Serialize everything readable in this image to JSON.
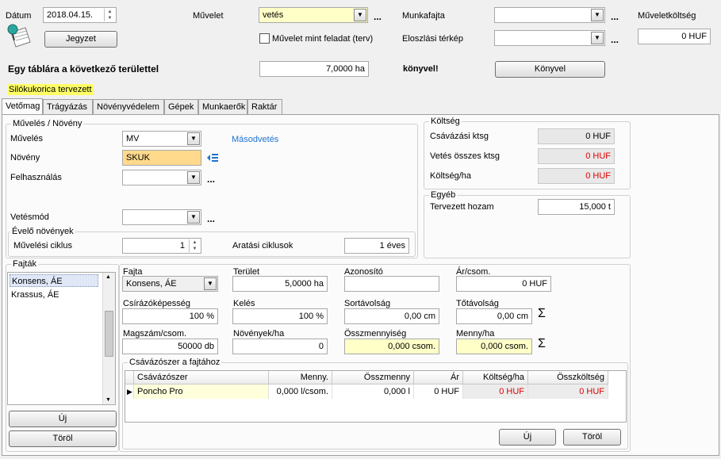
{
  "header": {
    "datum_label": "Dátum",
    "datum_value": "2018.04.15.",
    "jegyzet_button": "Jegyzet",
    "muvelet_label": "Művelet",
    "muvelet_value": "vetés",
    "muvelet_feladat_label": "Művelet mint feladat (terv)",
    "munkafajta_label": "Munkafajta",
    "munkafajta_value": "",
    "eloszlasi_label": "Eloszlási térkép",
    "eloszlasi_value": "",
    "muveletkoltseg_label": "Műveletköltség",
    "muveletkoltseg_value": "0 HUF",
    "dots": "..."
  },
  "book": {
    "text": "Egy táblára a következő területtel",
    "area_value": "7,0000 ha",
    "konyvel_text": "könyvel!",
    "konyvel_button": "Könyvel",
    "plan_name": "Silókukorica tervezett"
  },
  "tabs": [
    "Vetőmag",
    "Trágyázás",
    "Növényvédelem",
    "Gépek",
    "Munkaerők",
    "Raktár"
  ],
  "muveles": {
    "group_title": "Művelés / Növény",
    "muveles_label": "Művelés",
    "muveles_value": "MV",
    "masodvetes_link": "Másodvetés",
    "noveny_label": "Növény",
    "noveny_value": "SKUK",
    "felhasznalas_label": "Felhasználás",
    "felhasznalas_value": "",
    "vetesmod_label": "Vetésmód",
    "vetesmod_value": "",
    "evelo_title": "Évelő növények",
    "muveleci_ciklus_label": "Művelési ciklus",
    "muveleci_ciklus_value": "1",
    "aratasi_label": "Aratási ciklusok",
    "aratasi_value": "1 éves"
  },
  "koltseg": {
    "group_title": "Költség",
    "csavazasi_label": "Csávázási ktsg",
    "csavazasi_value": "0 HUF",
    "vetes_osszes_label": "Vetés összes ktsg",
    "vetes_osszes_value": "0 HUF",
    "koltseg_ha_label": "Költség/ha",
    "koltseg_ha_value": "0 HUF"
  },
  "egyeb": {
    "group_title": "Egyéb",
    "hozam_label": "Tervezett hozam",
    "hozam_value": "15,000 t"
  },
  "fajtak": {
    "group_title": "Fajták",
    "items": [
      "Konsens, ÁE",
      "Krassus, ÁE"
    ],
    "uj_button": "Új",
    "torol_button": "Töröl"
  },
  "fajta_detail": {
    "fajta_label": "Fajta",
    "fajta_value": "Konsens, ÁE",
    "terulet_label": "Terület",
    "terulet_value": "5,0000 ha",
    "azonosito_label": "Azonosító",
    "azonosito_value": "",
    "ar_csom_label": "Ár/csom.",
    "ar_csom_value": "0 HUF",
    "csirazo_label": "Csírázóképesség",
    "csirazo_value": "100 %",
    "keles_label": "Kelés",
    "keles_value": "100 %",
    "sortav_label": "Sortávolság",
    "sortav_value": "0,00 cm",
    "totav_label": "Tőtávolság",
    "totav_value": "0,00 cm",
    "magszam_label": "Magszám/csom.",
    "magszam_value": "50000 db",
    "noveny_ha_label": "Növények/ha",
    "noveny_ha_value": "0",
    "osszmenny_label": "Összmennyiség",
    "osszmenny_value": "0,000 csom.",
    "menny_ha_label": "Menny/ha",
    "menny_ha_value": "0,000 csom.",
    "sigma": "Σ"
  },
  "csavazoszer": {
    "group_title": "Csávázószer a fajtához",
    "columns": [
      "Csávázószer",
      "Menny.",
      "Összmenny",
      "Ár",
      "Költség/ha",
      "Összköltség"
    ],
    "rows": [
      {
        "name": "Poncho Pro",
        "menny": "0,000 l/csom.",
        "osszmenny": "0,000 l",
        "ar": "0 HUF",
        "koltseg_ha": "0 HUF",
        "osszkoltseg": "0 HUF"
      }
    ],
    "uj_button": "Új",
    "torol_button": "Töröl"
  }
}
